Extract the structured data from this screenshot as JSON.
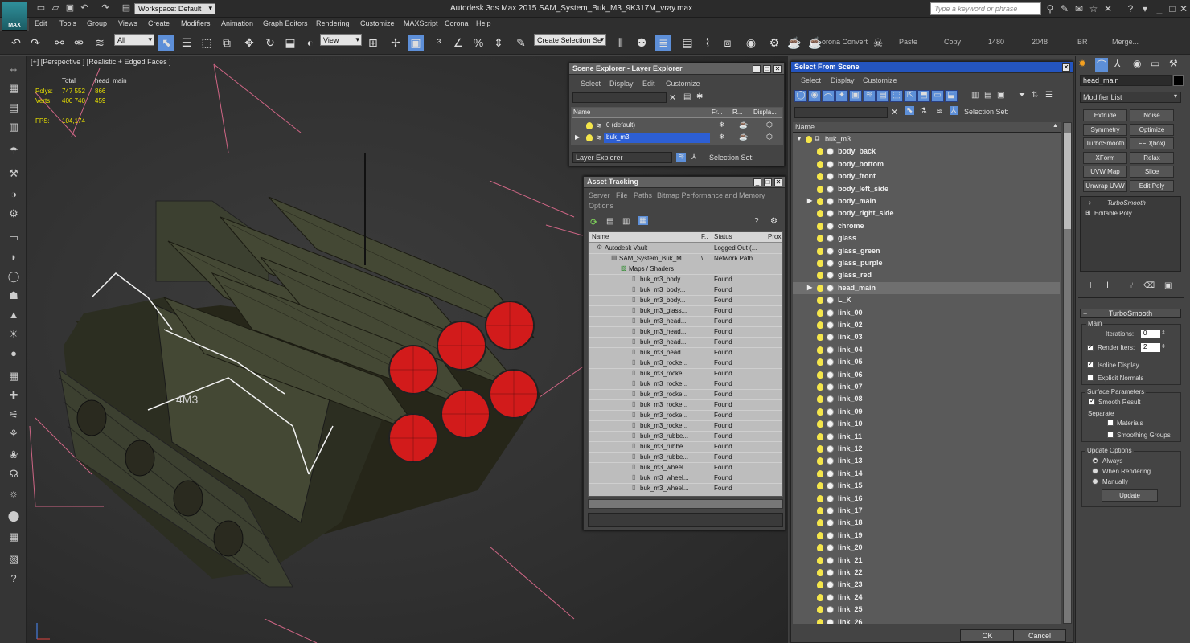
{
  "titlebar": {
    "logo": "MAX",
    "workspace": "Workspace: Default",
    "title": "Autodesk 3ds Max  2015      SAM_System_Buk_M3_9K317M_vray.max",
    "search_placeholder": "Type a keyword or phrase"
  },
  "menus": [
    "Edit",
    "Tools",
    "Group",
    "Views",
    "Create",
    "Modifiers",
    "Animation",
    "Graph Editors",
    "Rendering",
    "Customize",
    "MAXScript",
    "Corona",
    "Help"
  ],
  "toolbar": {
    "filter": "All",
    "refcoord": "View",
    "named_selection": "Create Selection Se",
    "labels": [
      "orona Convert",
      "Paste",
      "Copy",
      "1480",
      "2048",
      "BR",
      "Merge..."
    ]
  },
  "viewport": {
    "label": "[+] [Perspective ] [Realistic + Edged Faces ]",
    "stats": {
      "col1": "Total",
      "col2": "head_main",
      "polys_label": "Polys:",
      "polys_total": "747 552",
      "polys_sel": "866",
      "verts_label": "Verts:",
      "verts_total": "400 740",
      "verts_sel": "459",
      "fps_label": "FPS:",
      "fps": "104,174"
    },
    "decal": "4М3"
  },
  "scene_explorer": {
    "title": "Scene Explorer - Layer Explorer",
    "menus": [
      "Select",
      "Display",
      "Edit",
      "Customize"
    ],
    "columns": [
      "Name",
      "Fr...",
      "R...",
      "Displa..."
    ],
    "rows": [
      {
        "name": "0 (default)",
        "selected": false
      },
      {
        "name": "buk_m3",
        "selected": true
      }
    ],
    "footer_mode": "Layer Explorer",
    "selection_set": "Selection Set:"
  },
  "asset_tracking": {
    "title": "Asset Tracking",
    "menus": [
      "Server",
      "File",
      "Paths",
      "Bitmap Performance and Memory"
    ],
    "menu2": "Options",
    "columns": [
      "Name",
      "F..",
      "Status",
      "Prox"
    ],
    "rows": [
      {
        "name": "Autodesk Vault",
        "f": "",
        "status": "Logged Out (...",
        "indent": 1
      },
      {
        "name": "SAM_System_Buk_M...",
        "f": "\\...",
        "status": "Network Path",
        "indent": 2
      },
      {
        "name": "Maps / Shaders",
        "f": "",
        "status": "",
        "indent": 3
      },
      {
        "name": "buk_m3_body...",
        "f": "",
        "status": "Found",
        "indent": 4
      },
      {
        "name": "buk_m3_body...",
        "f": "",
        "status": "Found",
        "indent": 4
      },
      {
        "name": "buk_m3_body...",
        "f": "",
        "status": "Found",
        "indent": 4
      },
      {
        "name": "buk_m3_glass...",
        "f": "",
        "status": "Found",
        "indent": 4
      },
      {
        "name": "buk_m3_head...",
        "f": "",
        "status": "Found",
        "indent": 4
      },
      {
        "name": "buk_m3_head...",
        "f": "",
        "status": "Found",
        "indent": 4
      },
      {
        "name": "buk_m3_head...",
        "f": "",
        "status": "Found",
        "indent": 4
      },
      {
        "name": "buk_m3_head...",
        "f": "",
        "status": "Found",
        "indent": 4
      },
      {
        "name": "buk_m3_rocke...",
        "f": "",
        "status": "Found",
        "indent": 4
      },
      {
        "name": "buk_m3_rocke...",
        "f": "",
        "status": "Found",
        "indent": 4
      },
      {
        "name": "buk_m3_rocke...",
        "f": "",
        "status": "Found",
        "indent": 4
      },
      {
        "name": "buk_m3_rocke...",
        "f": "",
        "status": "Found",
        "indent": 4
      },
      {
        "name": "buk_m3_rocke...",
        "f": "",
        "status": "Found",
        "indent": 4
      },
      {
        "name": "buk_m3_rocke...",
        "f": "",
        "status": "Found",
        "indent": 4
      },
      {
        "name": "buk_m3_rocke...",
        "f": "",
        "status": "Found",
        "indent": 4
      },
      {
        "name": "buk_m3_rubbe...",
        "f": "",
        "status": "Found",
        "indent": 4
      },
      {
        "name": "buk_m3_rubbe...",
        "f": "",
        "status": "Found",
        "indent": 4
      },
      {
        "name": "buk_m3_rubbe...",
        "f": "",
        "status": "Found",
        "indent": 4
      },
      {
        "name": "buk_m3_wheel...",
        "f": "",
        "status": "Found",
        "indent": 4
      },
      {
        "name": "buk_m3_wheel...",
        "f": "",
        "status": "Found",
        "indent": 4
      },
      {
        "name": "buk_m3_wheel...",
        "f": "",
        "status": "Found",
        "indent": 4
      }
    ]
  },
  "select_from_scene": {
    "title": "Select From Scene",
    "menus": [
      "Select",
      "Display",
      "Customize"
    ],
    "selection_set": "Selection Set:",
    "column": "Name",
    "root": "buk_m3",
    "items": [
      {
        "name": "body_back",
        "expand": false,
        "hl": false
      },
      {
        "name": "body_bottom",
        "expand": false,
        "hl": false
      },
      {
        "name": "body_front",
        "expand": false,
        "hl": false
      },
      {
        "name": "body_left_side",
        "expand": false,
        "hl": false
      },
      {
        "name": "body_main",
        "expand": true,
        "hl": false
      },
      {
        "name": "body_right_side",
        "expand": false,
        "hl": false
      },
      {
        "name": "chrome",
        "expand": false,
        "hl": false
      },
      {
        "name": "glass",
        "expand": false,
        "hl": false
      },
      {
        "name": "glass_green",
        "expand": false,
        "hl": false
      },
      {
        "name": "glass_purple",
        "expand": false,
        "hl": false
      },
      {
        "name": "glass_red",
        "expand": false,
        "hl": false
      },
      {
        "name": "head_main",
        "expand": true,
        "hl": true
      },
      {
        "name": "L_K",
        "expand": false,
        "hl": false
      },
      {
        "name": "link_00",
        "expand": false,
        "hl": false
      },
      {
        "name": "link_02",
        "expand": false,
        "hl": false
      },
      {
        "name": "link_03",
        "expand": false,
        "hl": false
      },
      {
        "name": "link_04",
        "expand": false,
        "hl": false
      },
      {
        "name": "link_05",
        "expand": false,
        "hl": false
      },
      {
        "name": "link_06",
        "expand": false,
        "hl": false
      },
      {
        "name": "link_07",
        "expand": false,
        "hl": false
      },
      {
        "name": "link_08",
        "expand": false,
        "hl": false
      },
      {
        "name": "link_09",
        "expand": false,
        "hl": false
      },
      {
        "name": "link_10",
        "expand": false,
        "hl": false
      },
      {
        "name": "link_11",
        "expand": false,
        "hl": false
      },
      {
        "name": "link_12",
        "expand": false,
        "hl": false
      },
      {
        "name": "link_13",
        "expand": false,
        "hl": false
      },
      {
        "name": "link_14",
        "expand": false,
        "hl": false
      },
      {
        "name": "link_15",
        "expand": false,
        "hl": false
      },
      {
        "name": "link_16",
        "expand": false,
        "hl": false
      },
      {
        "name": "link_17",
        "expand": false,
        "hl": false
      },
      {
        "name": "link_18",
        "expand": false,
        "hl": false
      },
      {
        "name": "link_19",
        "expand": false,
        "hl": false
      },
      {
        "name": "link_20",
        "expand": false,
        "hl": false
      },
      {
        "name": "link_21",
        "expand": false,
        "hl": false
      },
      {
        "name": "link_22",
        "expand": false,
        "hl": false
      },
      {
        "name": "link_23",
        "expand": false,
        "hl": false
      },
      {
        "name": "link_24",
        "expand": false,
        "hl": false
      },
      {
        "name": "link_25",
        "expand": false,
        "hl": false
      },
      {
        "name": "link_26",
        "expand": false,
        "hl": false
      }
    ],
    "ok": "OK",
    "cancel": "Cancel"
  },
  "command_panel": {
    "object_name": "head_main",
    "modifier_list": "Modifier List",
    "buttons": [
      "Extrude",
      "Noise",
      "Symmetry",
      "Optimize",
      "TurboSmooth",
      "FFD(box)",
      "XForm",
      "Relax",
      "UVW Map",
      "Slice",
      "Unwrap UVW",
      "Edit Poly"
    ],
    "stack": [
      "TurboSmooth",
      "Editable Poly"
    ],
    "rollout": "TurboSmooth",
    "main": "Main",
    "iterations_label": "Iterations:",
    "iterations": "0",
    "render_iters_label": "Render Iters:",
    "render_iters": "2",
    "isoline": "Isoline Display",
    "explicit_normals": "Explicit Normals",
    "surface_params": "Surface Parameters",
    "smooth_result": "Smooth Result",
    "separate": "Separate",
    "materials": "Materials",
    "smoothing_groups": "Smoothing Groups",
    "update_options": "Update Options",
    "always": "Always",
    "when_rendering": "When Rendering",
    "manually": "Manually",
    "update": "Update"
  },
  "colors": {
    "accent": "#2d5fd4",
    "rocket_cap": "#d21b1b",
    "vehicle": "#3a3d2a"
  }
}
